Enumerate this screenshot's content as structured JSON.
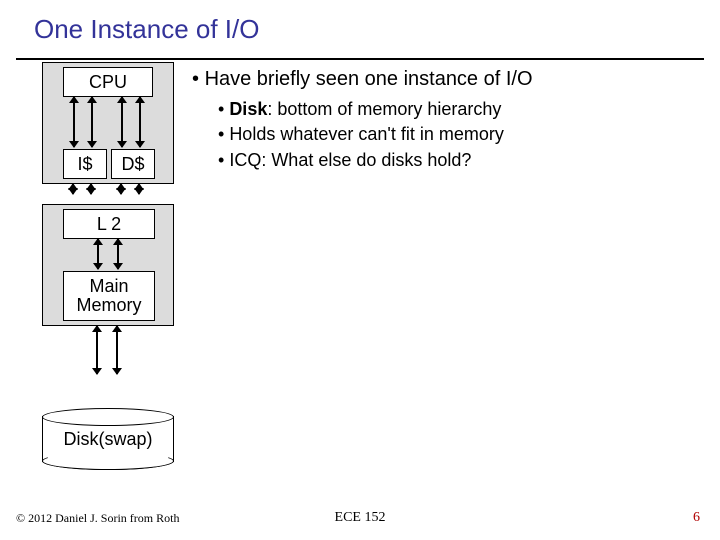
{
  "title": "One Instance of I/O",
  "diagram": {
    "cpu": "CPU",
    "ic": "I$",
    "dc": "D$",
    "l2": "L 2",
    "main1": "Main",
    "main2": "Memory",
    "disk": "Disk(swap)"
  },
  "bullets": {
    "b1": "Have briefly seen one instance of I/O",
    "s1_strong": "Disk",
    "s1_rest": ": bottom of memory hierarchy",
    "s2": "Holds whatever can't fit in memory",
    "s3": "ICQ: What else do disks hold?"
  },
  "footer": {
    "left": "© 2012 Daniel J. Sorin from Roth",
    "center": "ECE 152",
    "right": "6"
  }
}
